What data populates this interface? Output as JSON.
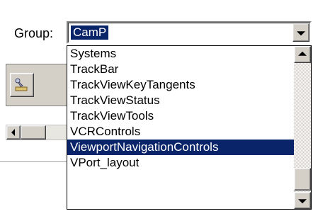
{
  "group": {
    "label": "Group:",
    "selected_value": "CamP"
  },
  "dropdown": {
    "items": [
      {
        "label": "Systems",
        "selected": false
      },
      {
        "label": "TrackBar",
        "selected": false
      },
      {
        "label": "TrackViewKeyTangents",
        "selected": false
      },
      {
        "label": "TrackViewStatus",
        "selected": false
      },
      {
        "label": "TrackViewTools",
        "selected": false
      },
      {
        "label": "VCRControls",
        "selected": false
      },
      {
        "label": "ViewportNavigationControls",
        "selected": true
      },
      {
        "label": "VPort_layout",
        "selected": false
      }
    ],
    "scroll_position": 0.9
  },
  "colors": {
    "selection": "#0a246a",
    "button_face": "#d4d0c8"
  },
  "icons": [
    "chevron-down-icon",
    "chevron-up-icon",
    "chevron-left-icon",
    "toolbar-tool-icon"
  ]
}
